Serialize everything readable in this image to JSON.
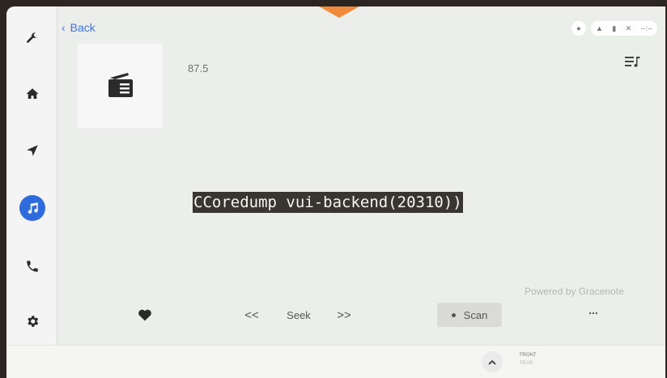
{
  "nav": {
    "back_label": "Back"
  },
  "station": {
    "frequency": "87.5"
  },
  "overlay": {
    "error_text": "CCoredump vui-backend(20310))"
  },
  "attribution": {
    "powered_by": "Powered by Gracenote"
  },
  "controls": {
    "prev_seek": "<<",
    "seek_label": "Seek",
    "next_seek": ">>",
    "scan_label": "Scan",
    "more_label": "..."
  },
  "status_bar": {
    "time": "--:--"
  },
  "climate": {
    "front_label": "FRONT",
    "rear_label": "REAR"
  },
  "sidebar_icons": [
    "wrench-icon",
    "home-icon",
    "navigation-icon",
    "music-icon",
    "phone-icon",
    "gear-icon"
  ],
  "colors": {
    "accent": "#2e6bdc",
    "notch": "#ef8a3a",
    "overlay_bg": "#393632"
  }
}
